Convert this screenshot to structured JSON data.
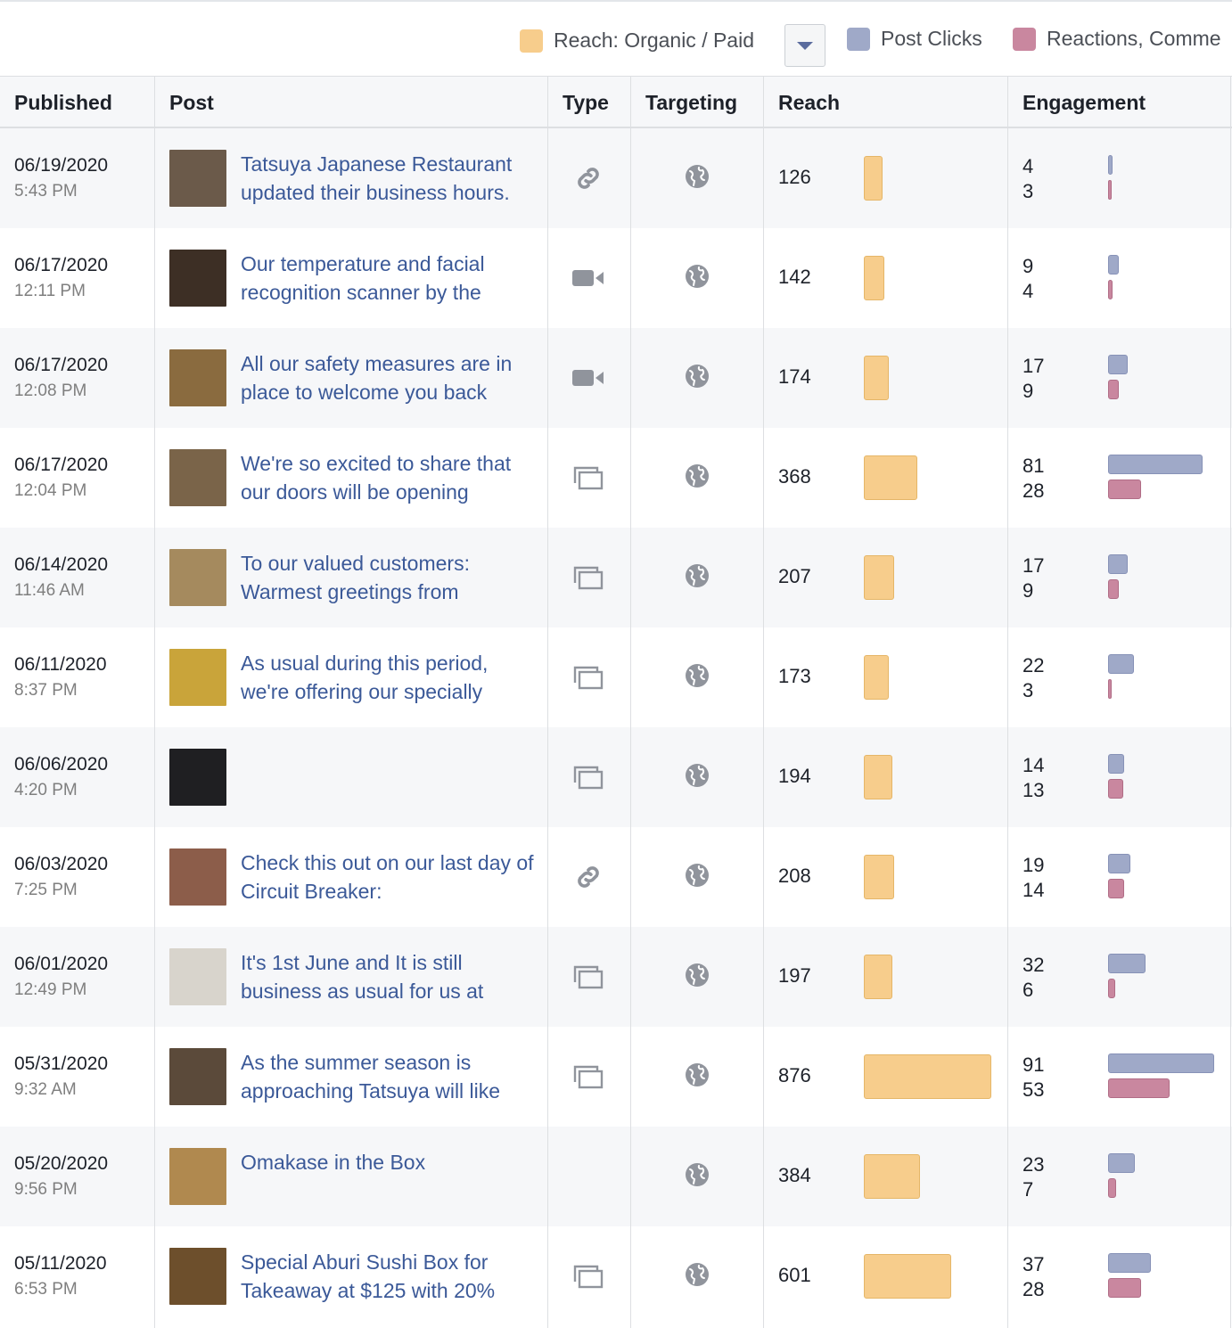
{
  "legend": {
    "reach_label": "Reach: Organic / Paid",
    "clicks_label": "Post Clicks",
    "reactions_label": "Reactions, Comme",
    "colors": {
      "reach": "#f7cd8c",
      "clicks": "#9fa9c8",
      "reactions": "#c9879f"
    }
  },
  "columns": {
    "published": "Published",
    "post": "Post",
    "type": "Type",
    "targeting": "Targeting",
    "reach": "Reach",
    "engagement": "Engagement"
  },
  "rows": [
    {
      "date": "06/19/2020",
      "time": "5:43 PM",
      "text": "Tatsuya Japanese Restaurant updated their business hours.",
      "type": "link-icon",
      "thumb": "#6b5a4a",
      "reach": 126,
      "clicks": 4,
      "reactions": 3
    },
    {
      "date": "06/17/2020",
      "time": "12:11 PM",
      "text": "Our temperature and facial recognition scanner by the",
      "type": "video-icon",
      "thumb": "#3d2f25",
      "reach": 142,
      "clicks": 9,
      "reactions": 4
    },
    {
      "date": "06/17/2020",
      "time": "12:08 PM",
      "text": "All our safety measures are in place to welcome you back",
      "type": "video-icon",
      "thumb": "#8a6b3f",
      "reach": 174,
      "clicks": 17,
      "reactions": 9
    },
    {
      "date": "06/17/2020",
      "time": "12:04 PM",
      "text": "We're so excited to share that our doors will be opening",
      "type": "album-icon",
      "thumb": "#7a6449",
      "reach": 368,
      "clicks": 81,
      "reactions": 28
    },
    {
      "date": "06/14/2020",
      "time": "11:46 AM",
      "text": "To our valued customers: Warmest greetings from",
      "type": "album-icon",
      "thumb": "#a58a5e",
      "reach": 207,
      "clicks": 17,
      "reactions": 9
    },
    {
      "date": "06/11/2020",
      "time": "8:37 PM",
      "text": "As usual during this period, we're offering our specially",
      "type": "album-icon",
      "thumb": "#c9a43a",
      "reach": 173,
      "clicks": 22,
      "reactions": 3
    },
    {
      "date": "06/06/2020",
      "time": "4:20 PM",
      "text": "",
      "type": "album-icon",
      "thumb": "#1f1f22",
      "reach": 194,
      "clicks": 14,
      "reactions": 13
    },
    {
      "date": "06/03/2020",
      "time": "7:25 PM",
      "text": "Check this out on our last day of Circuit Breaker:",
      "type": "link-icon",
      "thumb": "#8c5d4a",
      "reach": 208,
      "clicks": 19,
      "reactions": 14
    },
    {
      "date": "06/01/2020",
      "time": "12:49 PM",
      "text": "It's 1st June and It is still business as usual for us at",
      "type": "album-icon",
      "thumb": "#d8d4cc",
      "reach": 197,
      "clicks": 32,
      "reactions": 6
    },
    {
      "date": "05/31/2020",
      "time": "9:32 AM",
      "text": "As the summer season is approaching Tatsuya will like",
      "type": "album-icon",
      "thumb": "#5b4a3a",
      "reach": 876,
      "clicks": 91,
      "reactions": 53
    },
    {
      "date": "05/20/2020",
      "time": "9:56 PM",
      "text": "Omakase in the Box",
      "type": "none",
      "thumb": "#b0894f",
      "reach": 384,
      "clicks": 23,
      "reactions": 7
    },
    {
      "date": "05/11/2020",
      "time": "6:53 PM",
      "text": "Special Aburi Sushi Box for Takeaway at $125 with 20%",
      "type": "album-icon",
      "thumb": "#6d4f2c",
      "reach": 601,
      "clicks": 37,
      "reactions": 28
    }
  ]
}
